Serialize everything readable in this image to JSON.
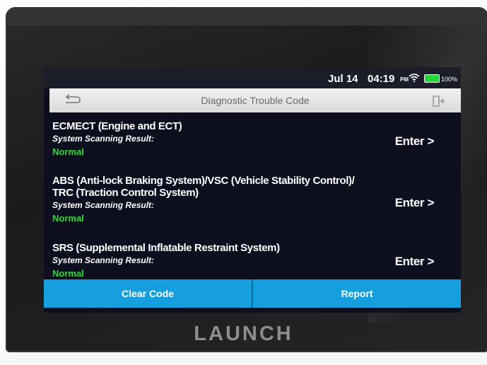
{
  "status_bar": {
    "date": "Jul 14",
    "time": "04:19",
    "ampm": "PM",
    "battery": "100%",
    "battery_color": "#27d63a"
  },
  "title_bar": {
    "title": "Diagnostic Trouble Code",
    "back_icon": "back-arrow-icon",
    "exit_icon": "exit-icon"
  },
  "systems": [
    {
      "name_lines": [
        "ECMECT (Engine and ECT)"
      ],
      "scan_label": "System Scanning Result:",
      "result": "Normal",
      "enter_label": "Enter >"
    },
    {
      "name_lines": [
        "ABS (Anti-lock Braking System)/VSC (Vehicle Stability Control)/",
        "TRC (Traction Control System)"
      ],
      "scan_label": "System Scanning Result:",
      "result": "Normal",
      "enter_label": "Enter >"
    },
    {
      "name_lines": [
        "SRS (Supplemental Inflatable Restraint System)"
      ],
      "scan_label": "System Scanning Result:",
      "result": "Normal",
      "enter_label": "Enter >"
    }
  ],
  "buttons": {
    "clear_code": "Clear Code",
    "report": "Report"
  },
  "brand": "LAUNCH",
  "colors": {
    "accent": "#169fdf",
    "normal_status": "#2bdc38",
    "screen_bg": "#0d0f1e"
  }
}
